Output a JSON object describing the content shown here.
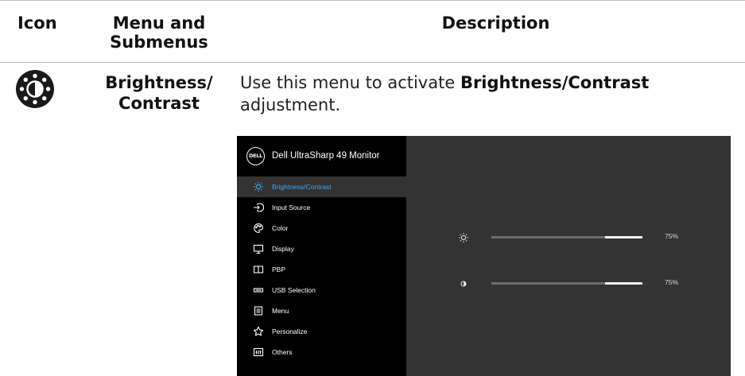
{
  "table": {
    "headers": {
      "icon": "Icon",
      "menu": "Menu and Submenus",
      "description": "Description"
    }
  },
  "row": {
    "icon": "brightness-contrast-icon",
    "menu_name_line1": "Brightness/",
    "menu_name_line2": "Contrast",
    "desc_prefix": "Use this menu to activate ",
    "desc_bold": "Brightness/Contrast",
    "desc_suffix": " adjustment."
  },
  "osd": {
    "logo_text": "DELL",
    "title": "Dell UltraSharp 49 Monitor",
    "menu_items": [
      {
        "label": "Brightness/Contrast",
        "icon": "brightness-icon",
        "selected": true
      },
      {
        "label": "Input Source",
        "icon": "input-source-icon",
        "selected": false
      },
      {
        "label": "Color",
        "icon": "color-icon",
        "selected": false
      },
      {
        "label": "Display",
        "icon": "display-icon",
        "selected": false
      },
      {
        "label": "PBP",
        "icon": "pbp-icon",
        "selected": false
      },
      {
        "label": "USB Selection",
        "icon": "usb-icon",
        "selected": false
      },
      {
        "label": "Menu",
        "icon": "menu-icon",
        "selected": false
      },
      {
        "label": "Personalize",
        "icon": "star-icon",
        "selected": false
      },
      {
        "label": "Others",
        "icon": "others-icon",
        "selected": false
      }
    ],
    "sliders": [
      {
        "name": "brightness",
        "icon": "brightness-icon",
        "value": 0.75,
        "label": "75%"
      },
      {
        "name": "contrast",
        "icon": "contrast-icon",
        "value": 0.75,
        "label": "75%"
      }
    ],
    "colors": {
      "accent": "#4aa3e8",
      "panel": "#333333",
      "sidebar": "#000000"
    }
  }
}
